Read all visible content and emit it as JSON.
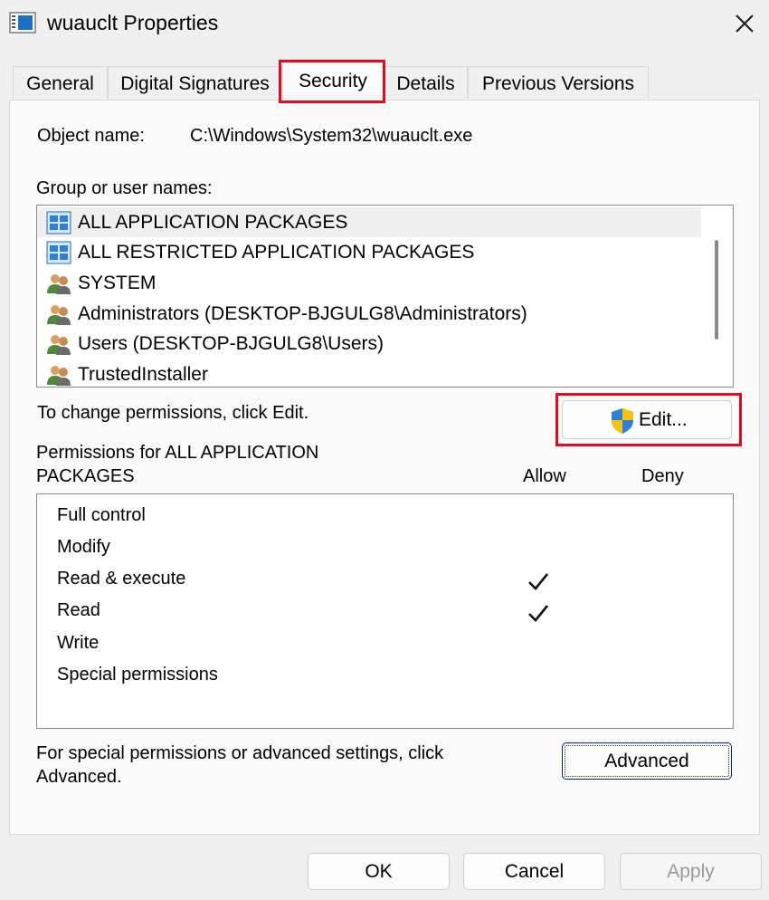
{
  "window": {
    "title": "wuauclt Properties",
    "app_icon": "properties-window-icon",
    "close_icon": "close-icon"
  },
  "tabs": [
    {
      "label": "General",
      "active": false
    },
    {
      "label": "Digital Signatures",
      "active": false
    },
    {
      "label": "Security",
      "active": true
    },
    {
      "label": "Details",
      "active": false
    },
    {
      "label": "Previous Versions",
      "active": false
    }
  ],
  "security": {
    "object_name_label": "Object name:",
    "object_name_value": "C:\\Windows\\System32\\wuauclt.exe",
    "groups_label": "Group or user names:",
    "groups": [
      {
        "name": "ALL APPLICATION PACKAGES",
        "icon": "app-packages-icon",
        "selected": true
      },
      {
        "name": "ALL RESTRICTED APPLICATION PACKAGES",
        "icon": "app-packages-icon",
        "selected": false
      },
      {
        "name": "SYSTEM",
        "icon": "users-group-icon",
        "selected": false
      },
      {
        "name": "Administrators (DESKTOP-BJGULG8\\Administrators)",
        "icon": "users-group-icon",
        "selected": false
      },
      {
        "name": "Users (DESKTOP-BJGULG8\\Users)",
        "icon": "users-group-icon",
        "selected": false
      },
      {
        "name": "TrustedInstaller",
        "icon": "users-group-icon",
        "selected": false
      }
    ],
    "change_hint": "To change permissions, click Edit.",
    "edit_button": "Edit...",
    "permissions_label_line1": "Permissions for ALL APPLICATION",
    "permissions_label_line2": "PACKAGES",
    "allow_header": "Allow",
    "deny_header": "Deny",
    "permissions": [
      {
        "name": "Full control",
        "allow": false,
        "deny": false
      },
      {
        "name": "Modify",
        "allow": false,
        "deny": false
      },
      {
        "name": "Read & execute",
        "allow": true,
        "deny": false
      },
      {
        "name": "Read",
        "allow": true,
        "deny": false
      },
      {
        "name": "Write",
        "allow": false,
        "deny": false
      },
      {
        "name": "Special permissions",
        "allow": false,
        "deny": false
      }
    ],
    "advanced_hint_line1": "For special permissions or advanced settings, click",
    "advanced_hint_line2": "Advanced.",
    "advanced_button": "Advanced"
  },
  "footer": {
    "ok": "OK",
    "cancel": "Cancel",
    "apply": "Apply"
  },
  "colors": {
    "highlight_box": "#e00b1c",
    "shield_blue": "#2f7fd6",
    "shield_yellow": "#f4c20d"
  }
}
